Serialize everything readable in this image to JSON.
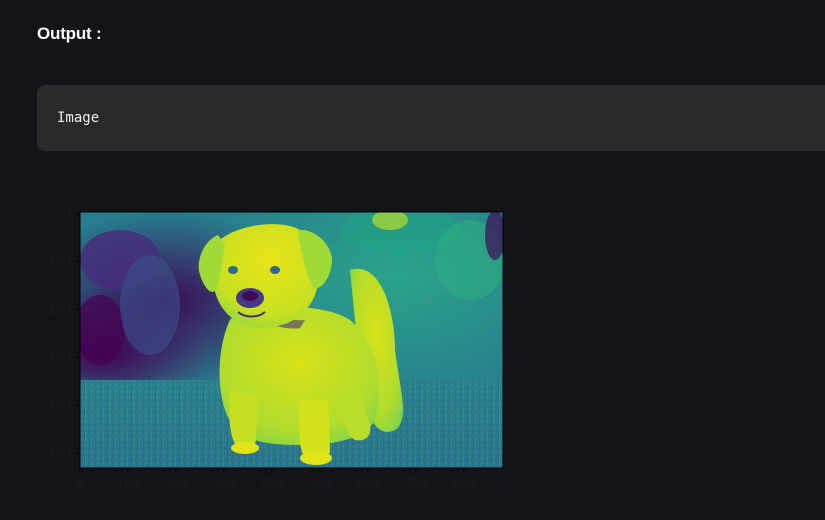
{
  "output_heading": "Output :",
  "code_block": {
    "text": "Image"
  },
  "figure": {
    "image_description": "puppy",
    "colormap": "viridis",
    "y_ticks": [
      "0",
      "100",
      "200",
      "300",
      "400",
      "500"
    ],
    "x_ticks": [
      "0",
      "100",
      "200",
      "300",
      "400",
      "500",
      "600",
      "700",
      "800"
    ],
    "colors": {
      "page_background": "#131417",
      "code_block_background": "#2a2a2d",
      "tick_label": "#1a1b1f"
    }
  }
}
